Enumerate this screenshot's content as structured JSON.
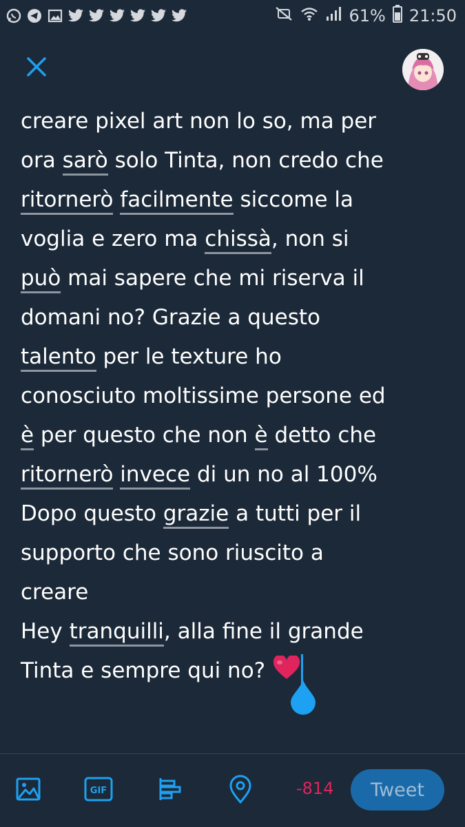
{
  "status_bar": {
    "battery": "61%",
    "time": "21:50",
    "left_icons": [
      "whatsapp-icon",
      "telegram-icon",
      "image-icon",
      "twitter-icon",
      "twitter-icon",
      "twitter-icon",
      "twitter-icon",
      "twitter-icon",
      "twitter-icon"
    ],
    "right_icons": [
      "mute-icon",
      "wifi-icon",
      "signal-icon"
    ]
  },
  "header": {
    "close_icon": "close-icon",
    "avatar": "profile-avatar"
  },
  "composer": {
    "lines": [
      [
        {
          "t": "creare pixel art non lo so, ma per"
        }
      ],
      [
        {
          "t": "ora "
        },
        {
          "t": "sarò",
          "u": true
        },
        {
          "t": " solo Tinta, non credo che"
        }
      ],
      [
        {
          "t": "ritornerò",
          "u": true
        },
        {
          "t": " "
        },
        {
          "t": "facilmente",
          "u": true
        },
        {
          "t": " siccome la"
        }
      ],
      [
        {
          "t": "voglia e zero ma "
        },
        {
          "t": "chissà",
          "u": true
        },
        {
          "t": ", non si"
        }
      ],
      [
        {
          "t": "può",
          "u": true
        },
        {
          "t": " mai sapere che mi riserva il"
        }
      ],
      [
        {
          "t": "domani no? Grazie a questo"
        }
      ],
      [
        {
          "t": "talento",
          "u": true
        },
        {
          "t": " per le texture ho"
        }
      ],
      [
        {
          "t": "conosciuto moltissime persone ed"
        }
      ],
      [
        {
          "t": "è",
          "u": true
        },
        {
          "t": " per questo che non "
        },
        {
          "t": "è",
          "u": true
        },
        {
          "t": " detto che"
        }
      ],
      [
        {
          "t": "ritornerò",
          "u": true
        },
        {
          "t": " "
        },
        {
          "t": "invece",
          "u": true
        },
        {
          "t": " di un no al 100%"
        }
      ],
      [
        {
          "t": "Dopo questo "
        },
        {
          "t": "grazie",
          "u": true
        },
        {
          "t": " a tutti per il"
        }
      ],
      [
        {
          "t": "supporto che sono riuscito a"
        }
      ],
      [
        {
          "t": "creare"
        }
      ],
      [
        {
          "t": "Hey "
        },
        {
          "t": "tranquilli",
          "u": true
        },
        {
          "t": ", alla fine il grande"
        }
      ],
      [
        {
          "t": "Tinta e sempre qui no? "
        },
        {
          "heart": true
        },
        {
          "cursor": true
        }
      ]
    ],
    "heart_color": "#e0245e",
    "cursor_color": "#1da1f2"
  },
  "toolbar": {
    "icons": [
      "image-icon",
      "gif-icon",
      "poll-icon",
      "location-icon"
    ],
    "gif_label": "GIF",
    "counter": "-814",
    "counter_color": "#e0245e",
    "tweet_label": "Tweet",
    "accent": "#1da1f2"
  }
}
